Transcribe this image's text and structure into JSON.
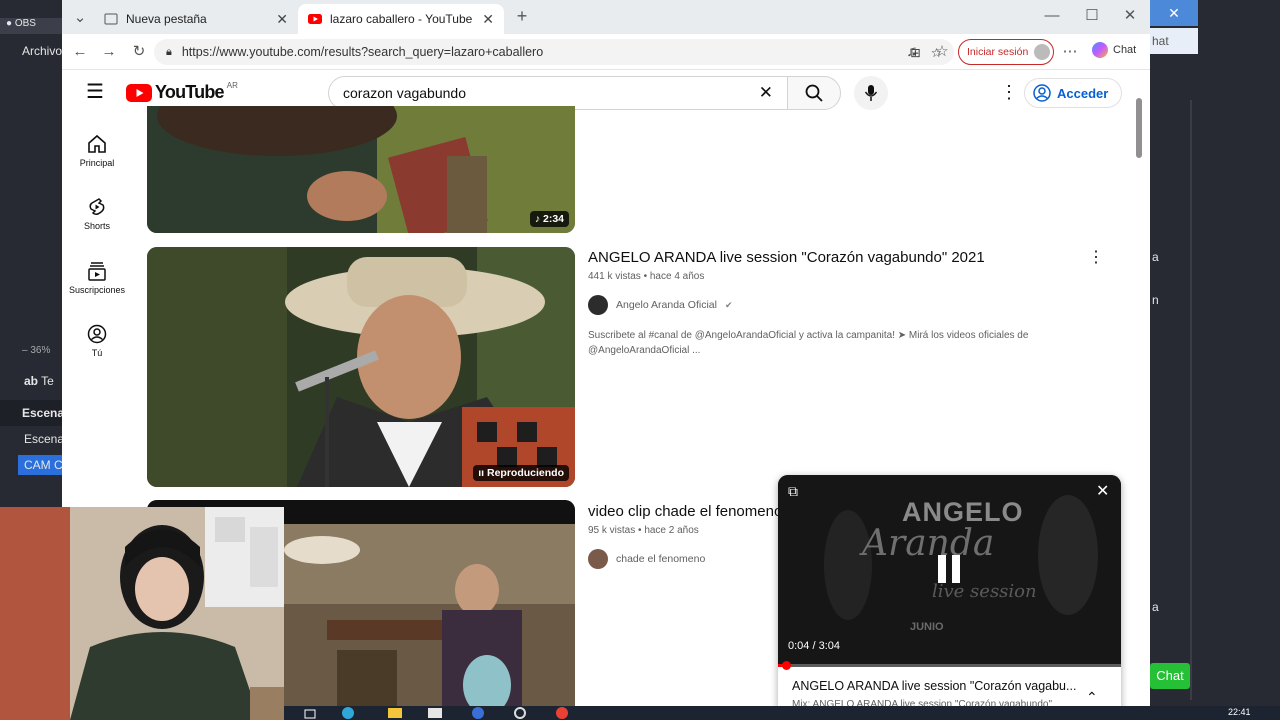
{
  "obs": {
    "left_tab": "OBS",
    "archivo": "Archivo",
    "zoom": "36%",
    "text_source": "Te",
    "escenas_header": "Escena",
    "escena_item": "Escena",
    "cam_item": "CAM C",
    "right_chat_top": "hat",
    "right_chat_button": "Chat",
    "right_letters": [
      "a",
      "n",
      "a"
    ]
  },
  "browser": {
    "tabs": [
      {
        "label": "Nueva pestaña",
        "active": false
      },
      {
        "label": "lazaro caballero - YouTube",
        "active": true
      }
    ],
    "url": "https://www.youtube.com/results?search_query=lazaro+caballero",
    "signin_label": "Iniciar sesión",
    "chat_label": "Chat"
  },
  "youtube": {
    "logo_text": "YouTube",
    "country": "AR",
    "search_value": "corazon vagabundo",
    "acceder_label": "Acceder",
    "guide": [
      {
        "label": "Principal",
        "icon": "home-icon"
      },
      {
        "label": "Shorts",
        "icon": "shorts-icon"
      },
      {
        "label": "Suscripciones",
        "icon": "subscriptions-icon"
      },
      {
        "label": "Tú",
        "icon": "you-icon"
      }
    ],
    "results": [
      {
        "duration": "2:34"
      },
      {
        "title": "ANGELO ARANDA live session \"Corazón vagabundo\" 2021",
        "views": "441 k vistas",
        "age": "hace 4 años",
        "channel": "Angelo Aranda Oficial",
        "description_1": "Suscribete al #canal de  @AngeloArandaOficial y activa la campanita! ➤ Mirá los videos oficiales de",
        "description_2": "@AngeloArandaOficial ...",
        "status": "Reproduciendo"
      },
      {
        "title": "video clip chade el fenomeno",
        "views": "95 k vistas",
        "age": "hace 2 años",
        "channel": "chade el fenomeno"
      }
    ],
    "miniplayer": {
      "overlay_line1": "ANGELO",
      "overlay_line2": "Aranda",
      "overlay_line3": "live session",
      "overlay_month": "JUNIO",
      "time": "0:04 / 3:04",
      "progress": 0.022,
      "title": "ANGELO ARANDA live session \"Corazón vagabu...",
      "subtitle": "Mix: ANGELO ARANDA live session \"Corazón vagabundo\""
    }
  },
  "taskbar": {
    "clock": "22:41"
  }
}
